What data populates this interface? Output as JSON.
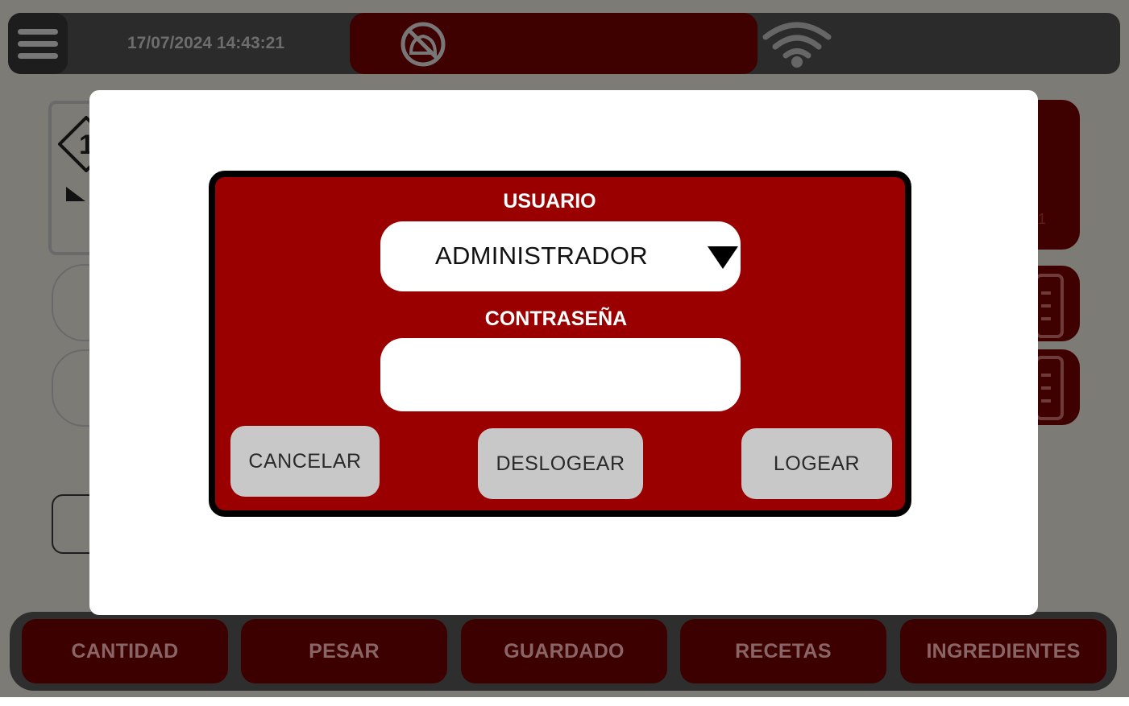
{
  "header": {
    "datetime": "17/07/2024 14:43:21",
    "menu_icon": "hamburger-menu-icon",
    "alarm_icon": "alarm-off-icon",
    "wifi_icon": "wifi-icon"
  },
  "background": {
    "card_number": "1",
    "right_panel_fragment": "1"
  },
  "login_dialog": {
    "user_label": "USUARIO",
    "user_selected": "ADMINISTRADOR",
    "password_label": "CONTRASEÑA",
    "password_value": "",
    "buttons": {
      "cancel": "CANCELAR",
      "logout": "DESLOGEAR",
      "login": "LOGEAR"
    }
  },
  "bottom_nav": {
    "items": [
      "CANTIDAD",
      "PESAR",
      "GUARDADO",
      "RECETAS",
      "INGREDIENTES"
    ]
  },
  "colors": {
    "panel_red": "#9b0000",
    "dark_red": "#3f0000",
    "button_grey": "#c8c8c8"
  }
}
